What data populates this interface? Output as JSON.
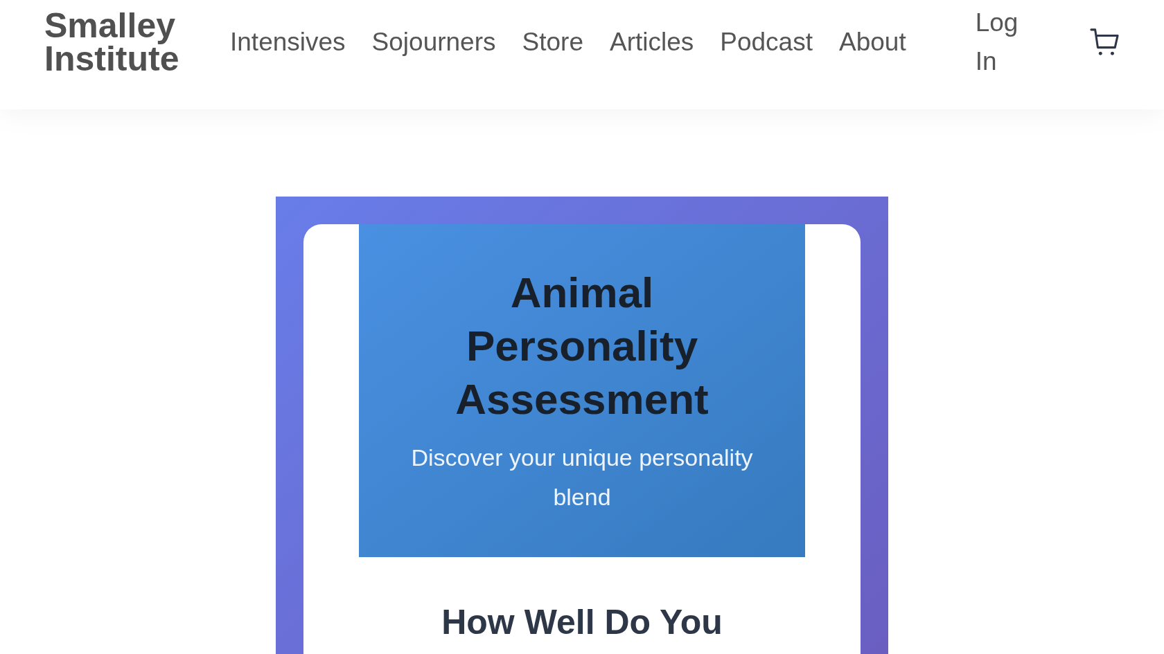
{
  "header": {
    "logo": "Smalley Institute",
    "nav": [
      "Intensives",
      "Sojourners",
      "Store",
      "Articles",
      "Podcast",
      "About"
    ],
    "login": "Log In"
  },
  "hero": {
    "title": "Animal Personality Assessment",
    "subtitle": "Discover your unique personality blend"
  },
  "section": {
    "heading": "How Well Do You"
  }
}
